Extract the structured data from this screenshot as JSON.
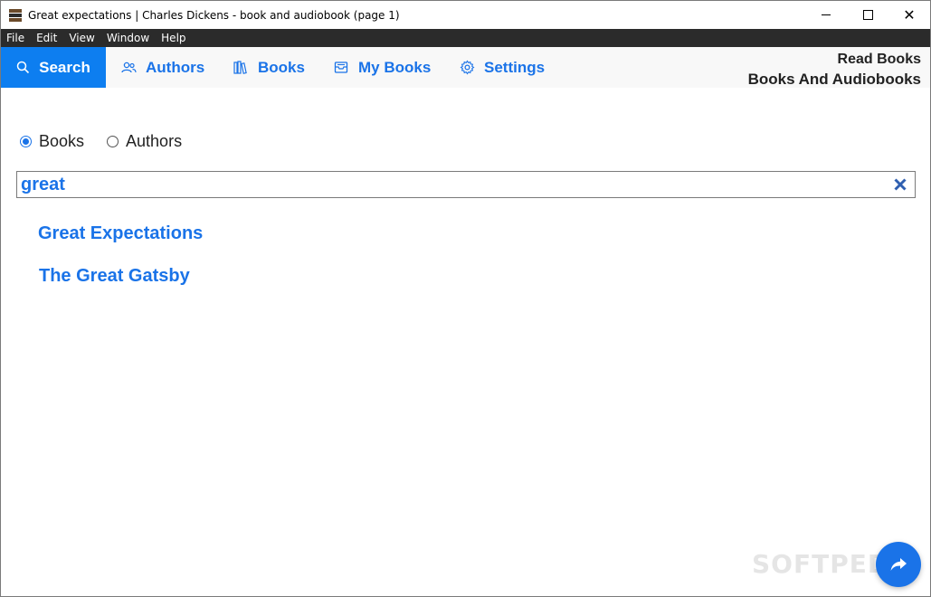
{
  "window": {
    "title": "Great expectations | Charles Dickens - book and audiobook (page 1)",
    "controls": {
      "minimize": "",
      "maximize": "",
      "close": "✕"
    }
  },
  "menu": [
    "File",
    "Edit",
    "View",
    "Window",
    "Help"
  ],
  "nav": {
    "tabs": [
      {
        "label": "Search",
        "icon": "search-icon",
        "active": true
      },
      {
        "label": "Authors",
        "icon": "users-icon",
        "active": false
      },
      {
        "label": "Books",
        "icon": "books-icon",
        "active": false
      },
      {
        "label": "My Books",
        "icon": "inbox-icon",
        "active": false
      },
      {
        "label": "Settings",
        "icon": "gear-icon",
        "active": false
      }
    ],
    "brand_line1": "Read Books",
    "brand_line2": "Books And Audiobooks"
  },
  "search": {
    "mode_options": [
      {
        "label": "Books",
        "checked": true
      },
      {
        "label": "Authors",
        "checked": false
      }
    ],
    "query": "great"
  },
  "results": [
    "Great Expectations",
    "The Great Gatsby"
  ],
  "watermark": "SOFTPEDIA",
  "colors": {
    "accent": "#1a73e8",
    "active_tab_bg": "#0d7ef0",
    "menubar_bg": "#2b2b2b"
  }
}
